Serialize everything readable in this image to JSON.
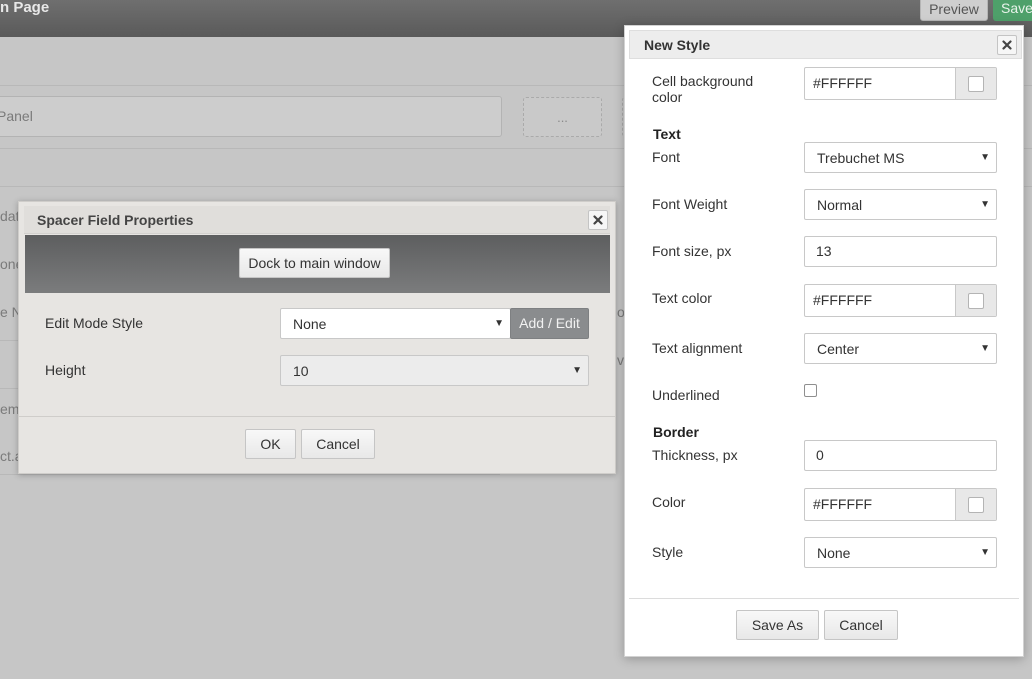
{
  "background": {
    "page_title": "n Page",
    "preview_label": "Preview",
    "save_label": "Save",
    "panel_input_placeholder": "Panel",
    "ellipsis_label": "...",
    "row_fragments": [
      "dat",
      "one",
      "e N",
      "em",
      "ct.a"
    ],
    "right_fragments": [
      "o",
      "v"
    ]
  },
  "spacer_dialog": {
    "title": "Spacer Field Properties",
    "dock_label": "Dock to main window",
    "edit_mode_style_label": "Edit Mode Style",
    "edit_mode_style_value": "None",
    "add_edit_label": "Add / Edit",
    "height_label": "Height",
    "height_value": "10",
    "ok_label": "OK",
    "cancel_label": "Cancel"
  },
  "style_dialog": {
    "title": "New Style",
    "cell_bg_label": "Cell background color",
    "cell_bg_value": "#FFFFFF",
    "text_section": "Text",
    "font_label": "Font",
    "font_value": "Trebuchet MS",
    "font_weight_label": "Font Weight",
    "font_weight_value": "Normal",
    "font_size_label": "Font size, px",
    "font_size_value": "13",
    "text_color_label": "Text color",
    "text_color_value": "#FFFFFF",
    "text_alignment_label": "Text alignment",
    "text_alignment_value": "Center",
    "underlined_label": "Underlined",
    "underlined_checked": false,
    "border_section": "Border",
    "thickness_label": "Thickness, px",
    "thickness_value": "0",
    "border_color_label": "Color",
    "border_color_value": "#FFFFFF",
    "border_style_label": "Style",
    "border_style_value": "None",
    "save_as_label": "Save As",
    "cancel_label": "Cancel"
  },
  "colors": {
    "topbar": "#636363",
    "save_accent": "#4ea06a",
    "dock_bar": "#6b6c6d",
    "overlay_bg": "#c6c6c6"
  }
}
